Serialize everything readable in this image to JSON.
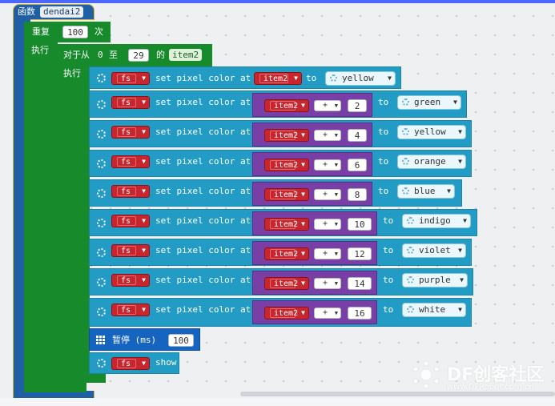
{
  "function": {
    "keyword": "函数",
    "name": "dendai2"
  },
  "repeat": {
    "keyword": "重复",
    "count": "100",
    "unit": "次",
    "do_label": "执行"
  },
  "for_loop": {
    "from_label": "对于从",
    "start": "0",
    "to_label": "至",
    "end": "29",
    "of_label": "的",
    "var": "item2",
    "do_label": "执行"
  },
  "strip_var": "fs",
  "set_label": "set pixel color at",
  "to_label": "to",
  "plus": "+",
  "pixel_rows": [
    {
      "index_var": "item2",
      "offset": null,
      "color": "yellow"
    },
    {
      "index_var": "item2",
      "offset": "2",
      "color": "green"
    },
    {
      "index_var": "item2",
      "offset": "4",
      "color": "yellow"
    },
    {
      "index_var": "item2",
      "offset": "6",
      "color": "orange"
    },
    {
      "index_var": "item2",
      "offset": "8",
      "color": "blue"
    },
    {
      "index_var": "item2",
      "offset": "10",
      "color": "indigo"
    },
    {
      "index_var": "item2",
      "offset": "12",
      "color": "violet"
    },
    {
      "index_var": "item2",
      "offset": "14",
      "color": "purple"
    },
    {
      "index_var": "item2",
      "offset": "16",
      "color": "white"
    }
  ],
  "pause": {
    "label": "暂停 (ms)",
    "value": "100"
  },
  "show": {
    "var": "fs",
    "label": "show"
  },
  "watermark": {
    "title": "DF创客社区",
    "url": "www.DFRobot.com.cn"
  }
}
